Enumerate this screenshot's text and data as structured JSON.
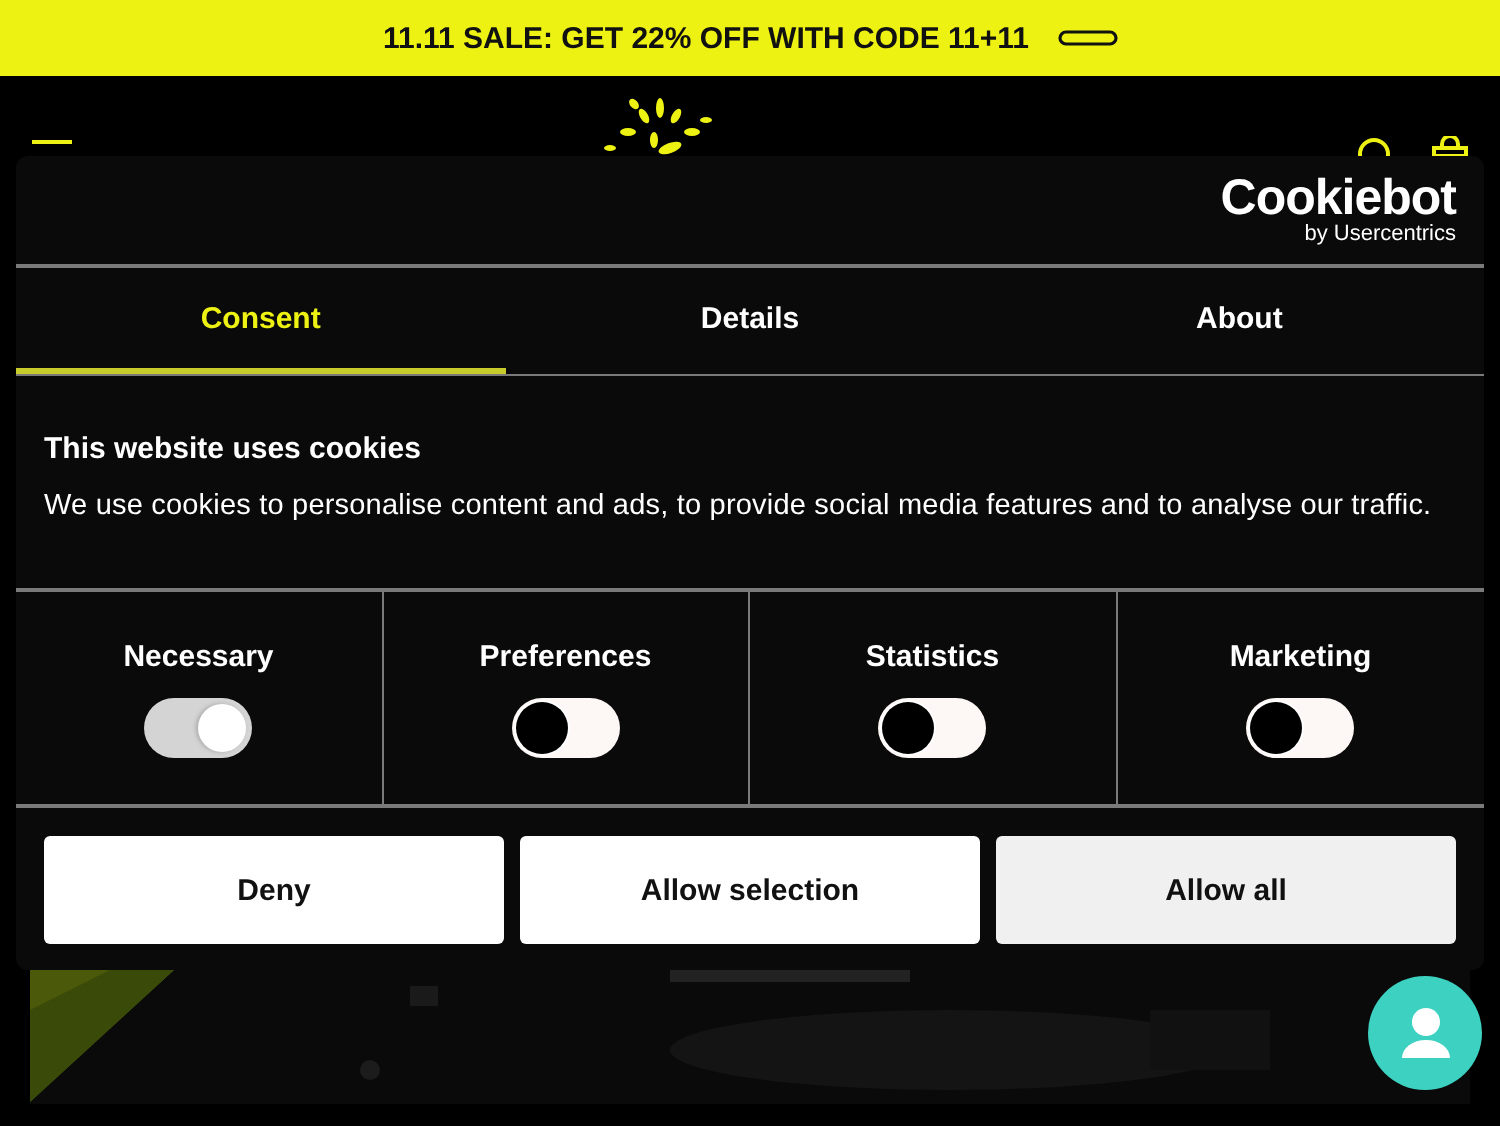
{
  "promo_banner": {
    "text": "11.11 SALE: GET 22% OFF WITH CODE 11+11"
  },
  "cookie_dialog": {
    "brand": {
      "name": "Cookiebot",
      "byline": "by Usercentrics"
    },
    "tabs": [
      {
        "label": "Consent",
        "selected": true
      },
      {
        "label": "Details",
        "selected": false
      },
      {
        "label": "About",
        "selected": false
      }
    ],
    "title": "This website uses cookies",
    "body": "We use cookies to personalise content and ads, to provide social media features and to analyse our traffic.",
    "categories": [
      {
        "label": "Necessary",
        "checked": true,
        "disabled": true
      },
      {
        "label": "Preferences",
        "checked": false,
        "disabled": false
      },
      {
        "label": "Statistics",
        "checked": false,
        "disabled": false
      },
      {
        "label": "Marketing",
        "checked": false,
        "disabled": false
      }
    ],
    "buttons": [
      {
        "label": "Deny",
        "kind": "plain"
      },
      {
        "label": "Allow selection",
        "kind": "plain"
      },
      {
        "label": "Allow all",
        "kind": "primary"
      }
    ]
  }
}
